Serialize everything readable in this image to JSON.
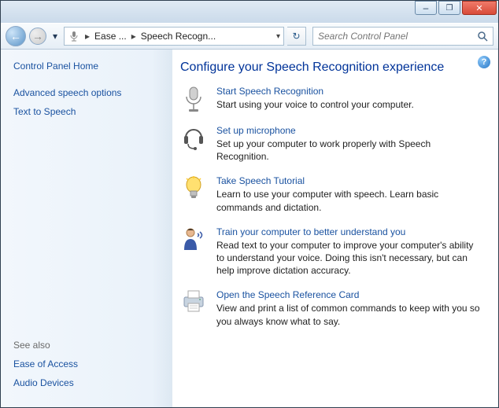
{
  "titlebar": {
    "min": "–",
    "max": "❐",
    "close": "✕"
  },
  "nav": {
    "back": "←",
    "fwd": "→",
    "chev": "▾",
    "refresh": "↻"
  },
  "breadcrumb": {
    "seg1": "Ease ...",
    "seg2": "Speech Recogn...",
    "sep": "▸",
    "dd": "▾"
  },
  "search": {
    "placeholder": "Search Control Panel"
  },
  "sidebar": {
    "home": "Control Panel Home",
    "adv": "Advanced speech options",
    "tts": "Text to Speech",
    "see": "See also",
    "ease": "Ease of Access",
    "audio": "Audio Devices"
  },
  "main": {
    "heading": "Configure your Speech Recognition experience",
    "help": "?",
    "tasks": [
      {
        "title": "Start Speech Recognition",
        "desc": "Start using your voice to control your computer."
      },
      {
        "title": "Set up microphone",
        "desc": "Set up your computer to work properly with Speech Recognition."
      },
      {
        "title": "Take Speech Tutorial",
        "desc": "Learn to use your computer with speech.  Learn basic commands and dictation."
      },
      {
        "title": "Train your computer to better understand you",
        "desc": "Read text to your computer to improve your computer's ability to understand your voice.  Doing this isn't necessary, but can help improve dictation accuracy."
      },
      {
        "title": "Open the Speech Reference Card",
        "desc": "View and print a list of common commands to keep with you so you always know what to say."
      }
    ]
  }
}
